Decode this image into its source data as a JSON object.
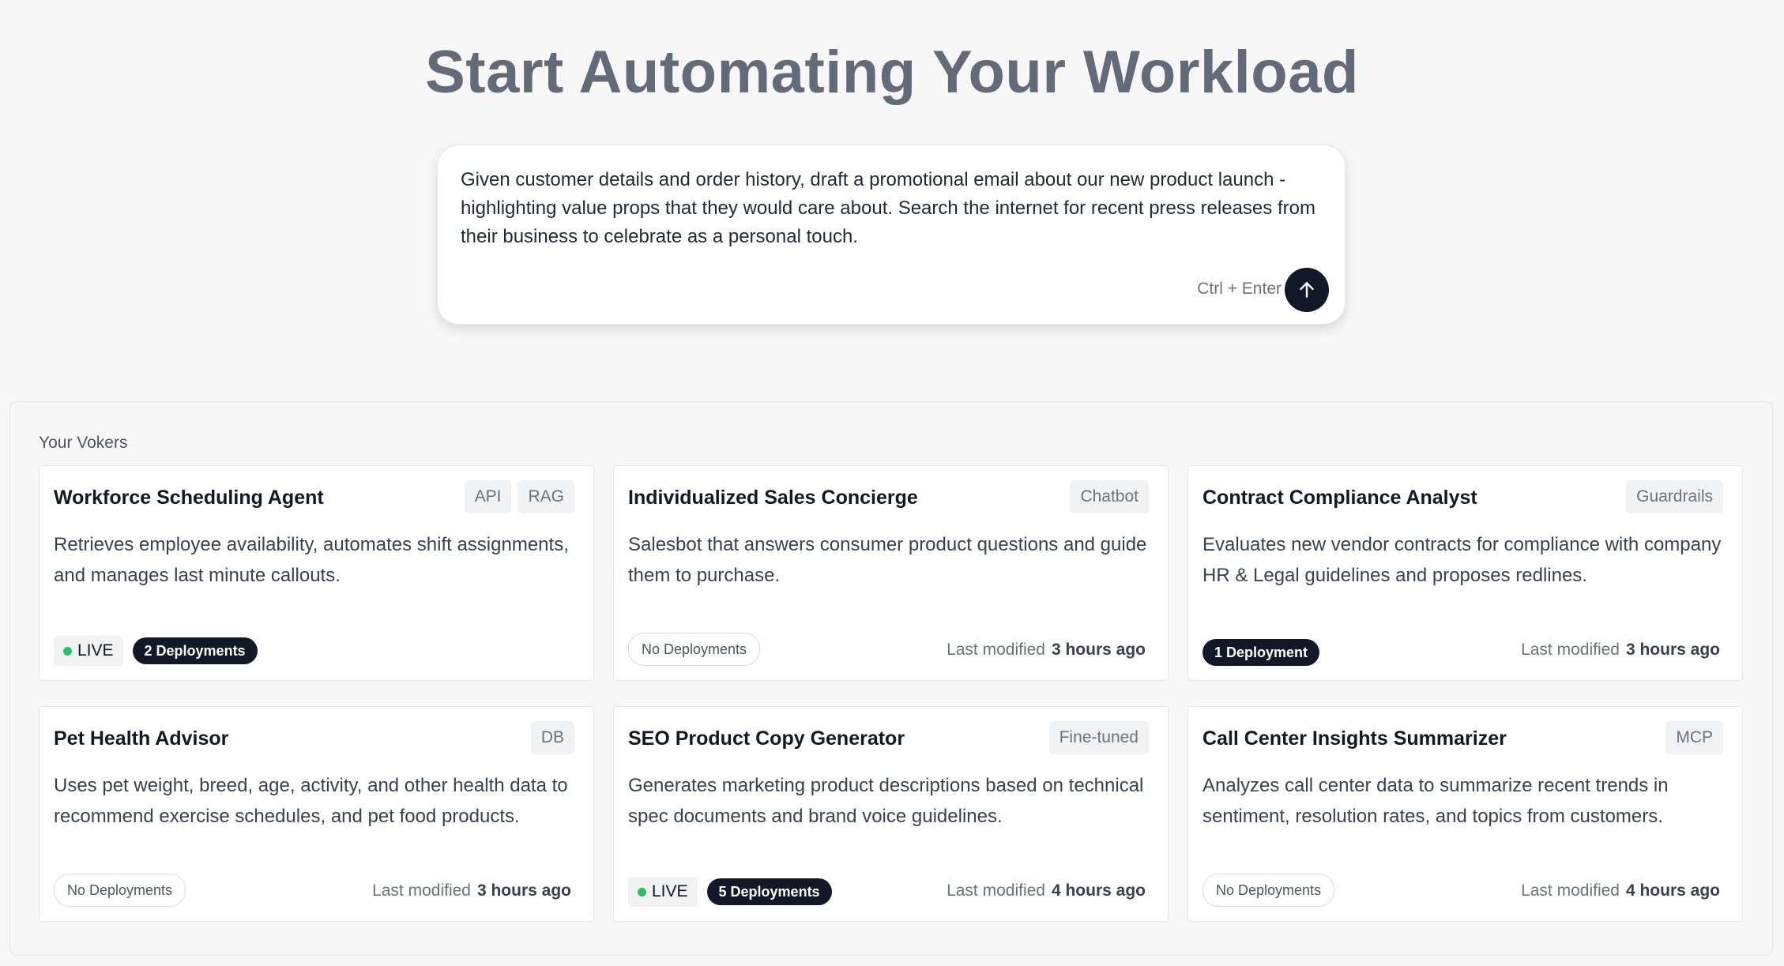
{
  "hero": {
    "title": "Start Automating Your Workload"
  },
  "prompt": {
    "value": "Given customer details and order history, draft a promotional email about our new product launch - highlighting value props that they would care about. Search the internet for recent press releases from their business to celebrate as a personal touch.",
    "shortcut_hint": "Ctrl + Enter",
    "submit_icon": "arrow-up-icon"
  },
  "vokers": {
    "section_label": "Your Vokers",
    "modified_label": "Last modified",
    "cards": [
      {
        "title": "Workforce Scheduling Agent",
        "tags": [
          "API",
          "RAG"
        ],
        "description": "Retrieves employee availability, automates shift assignments, and manages last minute callouts.",
        "live": "LIVE",
        "deployments": "2 Deployments",
        "deployed": true,
        "modified": ""
      },
      {
        "title": "Individualized Sales Concierge",
        "tags": [
          "Chatbot"
        ],
        "description": "Salesbot that answers consumer product questions and guide them to purchase.",
        "live": "",
        "deployments": "No Deployments",
        "deployed": false,
        "modified": "3 hours ago"
      },
      {
        "title": "Contract Compliance Analyst",
        "tags": [
          "Guardrails"
        ],
        "description": "Evaluates new vendor contracts for compliance with company HR & Legal guidelines and proposes redlines.",
        "live": "",
        "deployments": "1 Deployment",
        "deployed": true,
        "modified": "3 hours ago"
      },
      {
        "title": "Pet Health Advisor",
        "tags": [
          "DB"
        ],
        "description": "Uses pet weight, breed, age, activity, and other health data to recommend exercise schedules, and pet food products.",
        "live": "",
        "deployments": "No Deployments",
        "deployed": false,
        "modified": "3 hours ago"
      },
      {
        "title": "SEO Product Copy Generator",
        "tags": [
          "Fine-tuned"
        ],
        "description": "Generates marketing product descriptions based on technical spec documents and brand voice guidelines.",
        "live": "LIVE",
        "deployments": "5 Deployments",
        "deployed": true,
        "modified": "4 hours ago"
      },
      {
        "title": "Call Center Insights Summarizer",
        "tags": [
          "MCP"
        ],
        "description": "Analyzes call center data to summarize recent trends in sentiment, resolution rates, and topics from customers.",
        "live": "",
        "deployments": "No Deployments",
        "deployed": false,
        "modified": "4 hours ago"
      }
    ]
  },
  "colors": {
    "accent_dark": "#111827",
    "live_green": "#22c55e",
    "title_gray": "#646b78"
  }
}
